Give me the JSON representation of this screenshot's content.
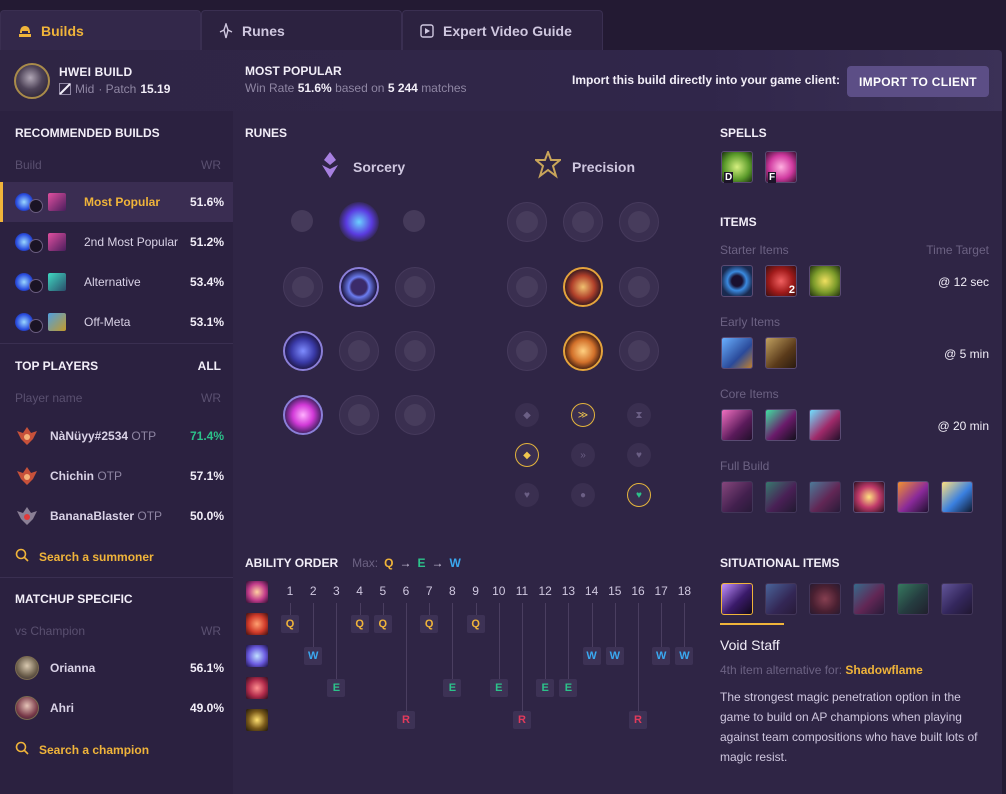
{
  "tabs": [
    {
      "label": "Builds",
      "icon": "helmet-icon",
      "active": true
    },
    {
      "label": "Runes",
      "icon": "runes-icon",
      "active": false
    },
    {
      "label": "Expert Video Guide",
      "icon": "video-icon",
      "active": false
    }
  ],
  "header": {
    "build_title": "HWEI BUILD",
    "role": "Mid",
    "patch_label": "· Patch",
    "patch_value": "15.19",
    "most_popular_title": "MOST POPULAR",
    "win_rate_label": "Win Rate",
    "win_rate_value": "51.6%",
    "based_on": "based on",
    "matches_value": "5 244",
    "matches_label": "matches",
    "import_text": "Import this build directly into your game client:",
    "import_button": "IMPORT TO CLIENT"
  },
  "sidebar": {
    "recommended_title": "RECOMMENDED BUILDS",
    "build_col": "Build",
    "wr_col": "WR",
    "builds": [
      {
        "label": "Most Popular",
        "wr": "51.6%",
        "selected": true
      },
      {
        "label": "2nd Most Popular",
        "wr": "51.2%",
        "selected": false
      },
      {
        "label": "Alternative",
        "wr": "53.4%",
        "selected": false
      },
      {
        "label": "Off-Meta",
        "wr": "53.1%",
        "selected": false
      }
    ],
    "top_players_title": "TOP PLAYERS",
    "top_players_filter": "ALL",
    "player_col": "Player name",
    "players": [
      {
        "name": "NàNüyy#2534",
        "tag": "OTP",
        "wr": "71.4%",
        "wr_color": "#2cc28a"
      },
      {
        "name": "Chichin",
        "tag": "OTP",
        "wr": "57.1%",
        "wr_color": "#f2eef8"
      },
      {
        "name": "BananaBlaster",
        "tag": "OTP",
        "wr": "50.0%",
        "wr_color": "#f2eef8"
      }
    ],
    "search_summoner": "Search a summoner",
    "matchup_title": "MATCHUP SPECIFIC",
    "vs_col": "vs Champion",
    "matchups": [
      {
        "name": "Orianna",
        "wr": "56.1%"
      },
      {
        "name": "Ahri",
        "wr": "49.0%"
      }
    ],
    "search_champion": "Search a champion"
  },
  "runes": {
    "title": "RUNES",
    "primary": "Sorcery",
    "secondary": "Precision"
  },
  "spells": {
    "title": "SPELLS",
    "keys": [
      "D",
      "F"
    ]
  },
  "items": {
    "title": "ITEMS",
    "time_target_label": "Time Target",
    "groups": [
      {
        "label": "Starter Items",
        "time": "@ 12 sec"
      },
      {
        "label": "Early Items",
        "time": "@ 5 min"
      },
      {
        "label": "Core Items",
        "time": "@ 20 min"
      },
      {
        "label": "Full Build",
        "time": ""
      }
    ],
    "potion_count": "2"
  },
  "ability_order": {
    "title": "ABILITY ORDER",
    "max_label": "Max:",
    "max_q": "Q",
    "max_e": "E",
    "max_w": "W",
    "arrow": "→",
    "levels": [
      "1",
      "2",
      "3",
      "4",
      "5",
      "6",
      "7",
      "8",
      "9",
      "10",
      "11",
      "12",
      "13",
      "14",
      "15",
      "16",
      "17",
      "18"
    ],
    "sequence": [
      "Q",
      "W",
      "E",
      "Q",
      "Q",
      "R",
      "Q",
      "E",
      "Q",
      "E",
      "R",
      "E",
      "E",
      "W",
      "W",
      "R",
      "W",
      "W"
    ]
  },
  "situational": {
    "title": "SITUATIONAL ITEMS",
    "name": "Void Staff",
    "alt_label": "4th item alternative for:",
    "alt_item": "Shadowflame",
    "description": "The strongest magic penetration option in the game to build on AP champions when playing against team compositions who have built lots of magic resist."
  },
  "colors": {
    "accent_gold": "#f0b43a",
    "skill_q": "#f0b43a",
    "skill_w": "#3aa8f0",
    "skill_e": "#2cc28a",
    "skill_r": "#e23a5c",
    "button": "#5c4e86"
  }
}
